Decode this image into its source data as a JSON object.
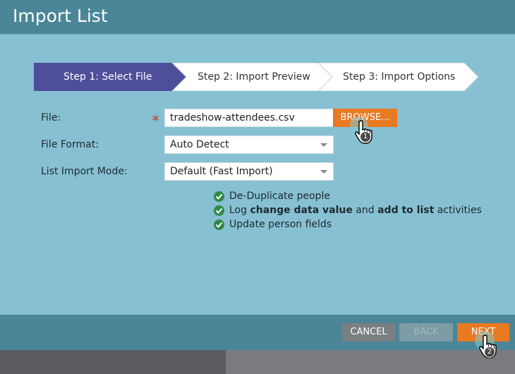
{
  "dialog": {
    "title": "Import List"
  },
  "wizard": {
    "steps": [
      {
        "label": "Step 1: Select File",
        "active": true
      },
      {
        "label": "Step 2: Import Preview",
        "active": false
      },
      {
        "label": "Step 3: Import Options",
        "active": false
      }
    ]
  },
  "form": {
    "file_label": "File:",
    "required_marker": "*",
    "file_value": "tradeshow-attendees.csv",
    "browse_label": "BROWSE...",
    "format_label": "File Format:",
    "format_value": "Auto Detect",
    "mode_label": "List Import Mode:",
    "mode_value": "Default (Fast Import)"
  },
  "options": {
    "dedupe": "De-Duplicate people",
    "log_prefix": "Log ",
    "log_bold1": "change data value",
    "log_mid": " and ",
    "log_bold2": "add to list",
    "log_suffix": " activities",
    "update": "Update person fields"
  },
  "footer": {
    "cancel_label": "CANCEL",
    "back_label": "BACK",
    "next_label": "NEXT"
  },
  "annotations": {
    "cursor1": "1",
    "cursor2": "2"
  },
  "colors": {
    "accent": "#e87a22",
    "header": "#4a8697",
    "body": "#87c0d3",
    "active_step": "#4e4f9a",
    "check": "#2f8a45"
  },
  "icons": [
    "check-icon",
    "hand-cursor-icon",
    "dropdown-caret-icon"
  ]
}
